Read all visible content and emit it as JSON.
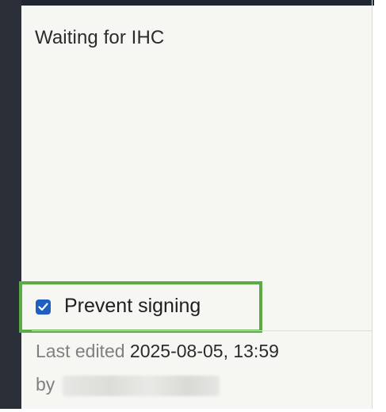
{
  "note": {
    "text": "Waiting for IHC"
  },
  "prevent_signing": {
    "label": "Prevent signing",
    "checked": true,
    "accent_color": "#1f5fbf",
    "highlight_color": "#5bab47"
  },
  "meta": {
    "edited_prefix": "Last edited",
    "edited_value": "2025-08-05, 13:59",
    "by_prefix": "by"
  }
}
